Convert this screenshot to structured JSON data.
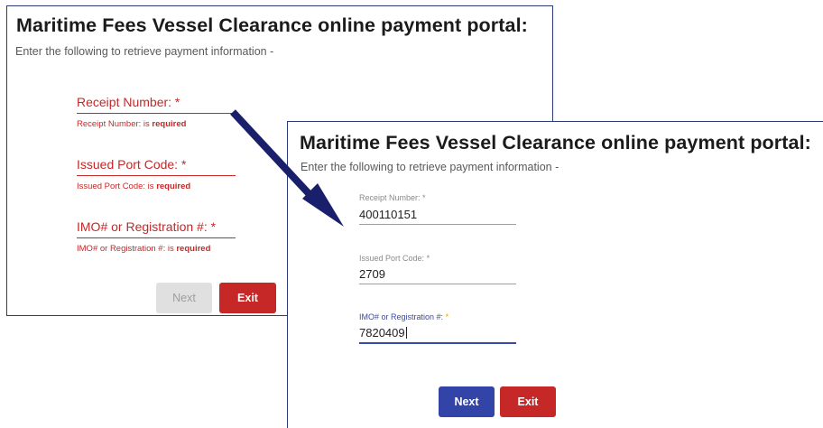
{
  "back_panel": {
    "title": "Maritime Fees Vessel Clearance online payment portal:",
    "subtitle": "Enter the following to retrieve payment information -",
    "fields": [
      {
        "label": "Receipt Number: *",
        "error_prefix": "Receipt Number: is",
        "error_suffix": "required"
      },
      {
        "label": "Issued Port Code: *",
        "error_prefix": "Issued Port Code: is",
        "error_suffix": "required"
      },
      {
        "label": "IMO# or Registration #: *",
        "error_prefix": "IMO# or Registration #: is",
        "error_suffix": "required"
      }
    ],
    "next_label": "Next",
    "exit_label": "Exit"
  },
  "front_panel": {
    "title": "Maritime Fees Vessel Clearance online payment portal:",
    "subtitle": "Enter the following to retrieve payment information -",
    "fields": [
      {
        "label": "Receipt Number:",
        "star": "*",
        "value": "400110151"
      },
      {
        "label": "Issued Port Code:",
        "star": "*",
        "value": "2709"
      },
      {
        "label": "IMO# or Registration #:",
        "star": "*",
        "value": "7820409"
      }
    ],
    "next_label": "Next",
    "exit_label": "Exit"
  },
  "colors": {
    "error": "#c62828",
    "primary": "#3344a8",
    "focus": "#3949ab",
    "arrow": "#1a1f6b",
    "panel_border": "#2c3a7a"
  }
}
